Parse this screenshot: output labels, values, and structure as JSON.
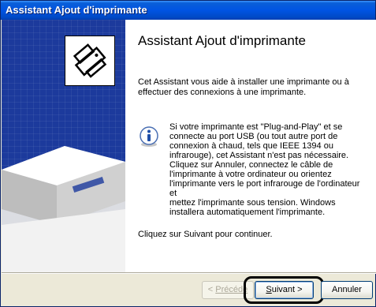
{
  "window": {
    "title": "Assistant Ajout d'imprimante"
  },
  "main": {
    "heading": "Assistant Ajout d'imprimante",
    "intro": "Cet Assistant vous aide à installer une imprimante ou à effectuer des connexions à une imprimante.",
    "info_lines": [
      "Si votre imprimante est \"Plug-and-Play\" et se",
      "connecte au port USB (ou tout autre port de",
      "connexion à chaud, tels que IEEE 1394 ou",
      "infrarouge), cet Assistant n'est pas nécessaire.",
      "Cliquez sur Annuler, connectez le câble de",
      "l'imprimante à votre ordinateur ou orientez",
      "l'imprimante vers le port infrarouge de l'ordinateur et",
      "mettez l'imprimante sous tension. Windows",
      "installera automatiquement l'imprimante."
    ],
    "continue_text": "Cliquez sur Suivant pour continuer."
  },
  "buttons": {
    "back_prefix": "< ",
    "back_label": "Précéde",
    "next_label_underlined": "S",
    "next_label_rest": "uivant >",
    "cancel_label": "Annuler"
  },
  "icons": {
    "wizard_logo": "printer-wizard-icon",
    "info": "info-icon"
  },
  "colors": {
    "titlebar": "#0054e3",
    "left_panel": "#1c3a9c",
    "dialog_bg": "#ece9d8"
  }
}
